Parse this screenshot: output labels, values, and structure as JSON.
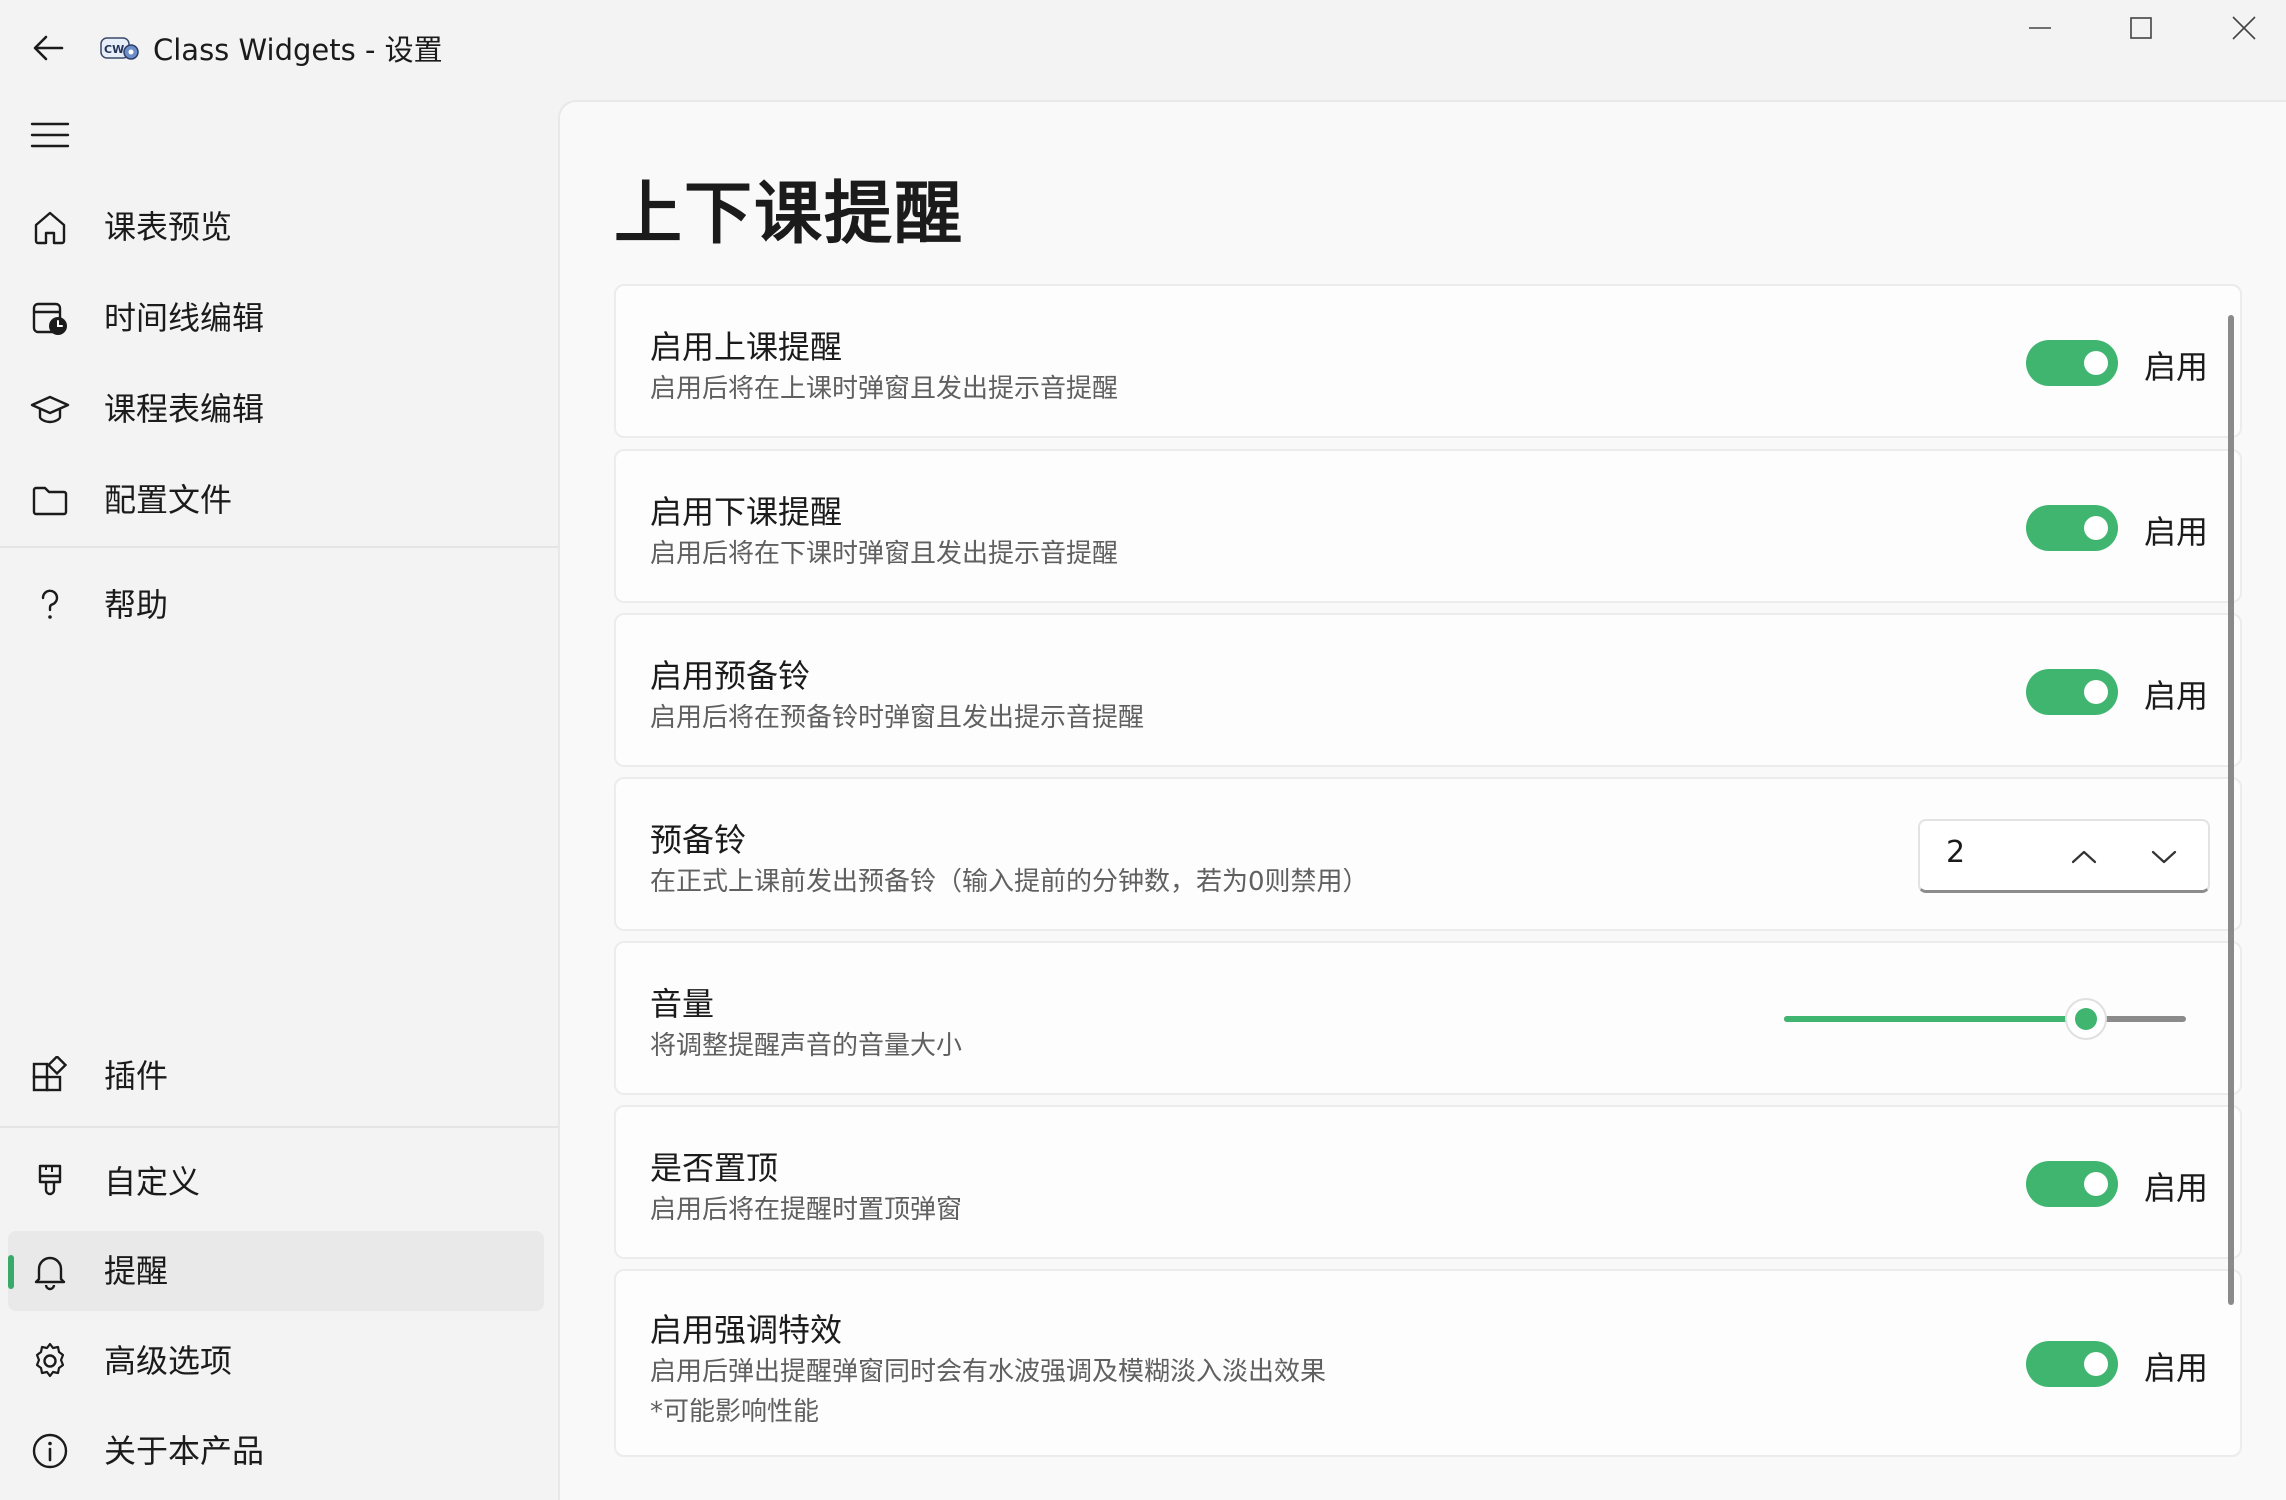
{
  "window": {
    "title": "Class Widgets - 设置",
    "logo_text": "CW",
    "controls": {
      "minimize": "minimize-icon",
      "maximize": "maximize-icon",
      "close": "close-icon"
    }
  },
  "sidebar": {
    "items_top": [
      {
        "label": "课表预览",
        "icon": "home-icon"
      },
      {
        "label": "时间线编辑",
        "icon": "calendar-clock-icon"
      },
      {
        "label": "课程表编辑",
        "icon": "education-cap-icon"
      },
      {
        "label": "配置文件",
        "icon": "folder-icon"
      }
    ],
    "help": {
      "label": "帮助",
      "icon": "question-icon"
    },
    "items_bottom": [
      {
        "label": "插件",
        "icon": "plugin-icon"
      },
      {
        "label": "自定义",
        "icon": "paintbrush-icon"
      },
      {
        "label": "提醒",
        "icon": "bell-icon",
        "selected": true
      },
      {
        "label": "高级选项",
        "icon": "gear-icon"
      },
      {
        "label": "关于本产品",
        "icon": "info-icon"
      }
    ]
  },
  "page": {
    "title": "上下课提醒",
    "settings": [
      {
        "title": "启用上课提醒",
        "desc": "启用后将在上课时弹窗且发出提示音提醒",
        "toggle": true,
        "toggle_label": "启用"
      },
      {
        "title": "启用下课提醒",
        "desc": "启用后将在下课时弹窗且发出提示音提醒",
        "toggle": true,
        "toggle_label": "启用"
      },
      {
        "title": "启用预备铃",
        "desc": "启用后将在预备铃时弹窗且发出提示音提醒",
        "toggle": true,
        "toggle_label": "启用"
      },
      {
        "title": "预备铃",
        "desc": "在正式上课前发出预备铃（输入提前的分钟数，若为0则禁用）",
        "spin_value": "2"
      },
      {
        "title": "音量",
        "desc": "将调整提醒声音的音量大小",
        "volume_fraction": 0.75
      },
      {
        "title": "是否置顶",
        "desc": "启用后将在提醒时置顶弹窗",
        "toggle": true,
        "toggle_label": "启用"
      },
      {
        "title": "启用强调特效",
        "desc": "启用后弹出提醒弹窗同时会有水波强调及模糊淡入淡出效果",
        "desc2": "*可能影响性能",
        "toggle": true,
        "toggle_label": "启用"
      }
    ]
  },
  "colors": {
    "accent": "#3fb56f",
    "selection_bg": "#e9e9e9"
  }
}
